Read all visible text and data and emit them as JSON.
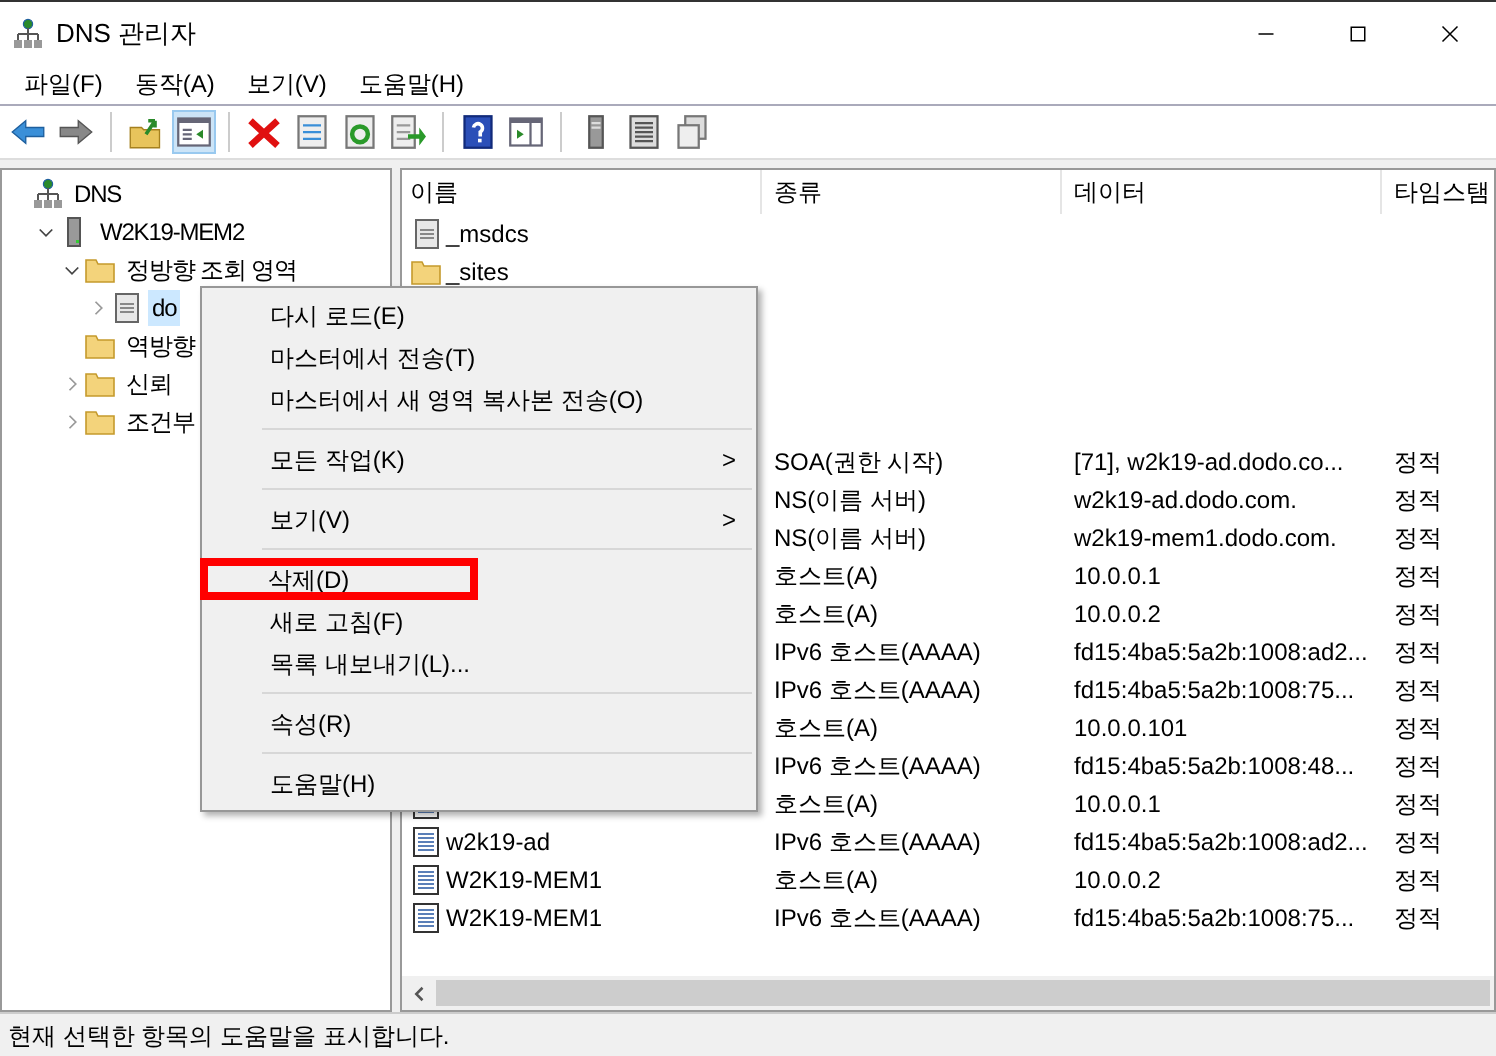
{
  "window": {
    "title": "DNS 관리자"
  },
  "menubar": [
    "파일(F)",
    "동작(A)",
    "보기(V)",
    "도움말(H)"
  ],
  "toolbar": [
    {
      "kind": "back",
      "pressed": false
    },
    {
      "kind": "forward",
      "pressed": false
    },
    {
      "kind": "separator"
    },
    {
      "kind": "up",
      "pressed": false
    },
    {
      "kind": "tree",
      "pressed": true
    },
    {
      "kind": "separator"
    },
    {
      "kind": "delete",
      "pressed": false
    },
    {
      "kind": "properties",
      "pressed": false
    },
    {
      "kind": "refresh",
      "pressed": false
    },
    {
      "kind": "export",
      "pressed": false
    },
    {
      "kind": "separator"
    },
    {
      "kind": "help",
      "pressed": false
    },
    {
      "kind": "pane",
      "pressed": false
    },
    {
      "kind": "separator"
    },
    {
      "kind": "server",
      "pressed": false
    },
    {
      "kind": "list",
      "pressed": false
    },
    {
      "kind": "copy",
      "pressed": false
    }
  ],
  "tree": [
    {
      "label": "DNS",
      "kind": "root",
      "selected": false,
      "children": [
        {
          "label": "W2K19-MEM2",
          "kind": "server",
          "expanded": true,
          "selected": false,
          "children": [
            {
              "label": "정방향 조회 영역",
              "kind": "folder",
              "expanded": true,
              "selected": false,
              "children": [
                {
                  "label": "do",
                  "kind": "zone",
                  "expanded": false,
                  "selected": true
                }
              ]
            },
            {
              "label": "역방향",
              "kind": "folder",
              "selected": false
            },
            {
              "label": "신뢰",
              "kind": "folder",
              "expanded": false,
              "selected": false
            },
            {
              "label": "조건부",
              "kind": "folder",
              "expanded": false,
              "selected": false
            }
          ]
        }
      ]
    }
  ],
  "table": {
    "columns": [
      "이름",
      "종류",
      "데이터",
      "타임스탬"
    ],
    "rows": [
      {
        "kind": "zone",
        "name": "_msdcs"
      },
      {
        "kind": "folder",
        "name": "_sites"
      },
      {
        "type": "SOA(권한 시작)",
        "data": "[71], w2k19-ad.dodo.co...",
        "timestamp": "정적"
      },
      {
        "type": "NS(이름 서버)",
        "data": "w2k19-ad.dodo.com.",
        "timestamp": "정적"
      },
      {
        "type": "NS(이름 서버)",
        "data": "w2k19-mem1.dodo.com.",
        "timestamp": "정적"
      },
      {
        "type": "호스트(A)",
        "data": "10.0.0.1",
        "timestamp": "정적"
      },
      {
        "type": "호스트(A)",
        "data": "10.0.0.2",
        "timestamp": "정적"
      },
      {
        "type": "IPv6 호스트(AAAA)",
        "data": "fd15:4ba5:5a2b:1008:ad2...",
        "timestamp": "정적"
      },
      {
        "type": "IPv6 호스트(AAAA)",
        "data": "fd15:4ba5:5a2b:1008:75...",
        "timestamp": "정적"
      },
      {
        "type": "호스트(A)",
        "data": "10.0.0.101",
        "timestamp": "정적"
      },
      {
        "type": "IPv6 호스트(AAAA)",
        "data": "fd15:4ba5:5a2b:1008:48...",
        "timestamp": "정적"
      },
      {
        "kind": "record",
        "type": "호스트(A)",
        "data": "10.0.0.1",
        "timestamp": "정적"
      },
      {
        "kind": "record",
        "name": "w2k19-ad",
        "type": "IPv6 호스트(AAAA)",
        "data": "fd15:4ba5:5a2b:1008:ad2...",
        "timestamp": "정적"
      },
      {
        "kind": "record",
        "name": "W2K19-MEM1",
        "type": "호스트(A)",
        "data": "10.0.0.2",
        "timestamp": "정적"
      },
      {
        "kind": "record",
        "name": "W2K19-MEM1",
        "type": "IPv6 호스트(AAAA)",
        "data": "fd15:4ba5:5a2b:1008:75...",
        "timestamp": "정적"
      }
    ]
  },
  "context_menu": {
    "items": [
      {
        "kind": "item",
        "label": "다시 로드(E)"
      },
      {
        "kind": "item",
        "label": "마스터에서 전송(T)"
      },
      {
        "kind": "item",
        "label": "마스터에서 새 영역 복사본 전송(O)"
      },
      {
        "kind": "separator"
      },
      {
        "kind": "submenu",
        "label": "모든 작업(K)",
        "arrow": ">"
      },
      {
        "kind": "separator"
      },
      {
        "kind": "submenu",
        "label": "보기(V)",
        "arrow": ">"
      },
      {
        "kind": "separator"
      },
      {
        "kind": "item",
        "label": "삭제(D)",
        "highlighted": true
      },
      {
        "kind": "item",
        "label": "새로 고침(F)"
      },
      {
        "kind": "item",
        "label": "목록 내보내기(L)..."
      },
      {
        "kind": "separator"
      },
      {
        "kind": "item",
        "label": "속성(R)"
      },
      {
        "kind": "separator"
      },
      {
        "kind": "item",
        "label": "도움말(H)"
      }
    ]
  },
  "status_bar": "현재 선택한 항목의 도움말을 표시합니다."
}
